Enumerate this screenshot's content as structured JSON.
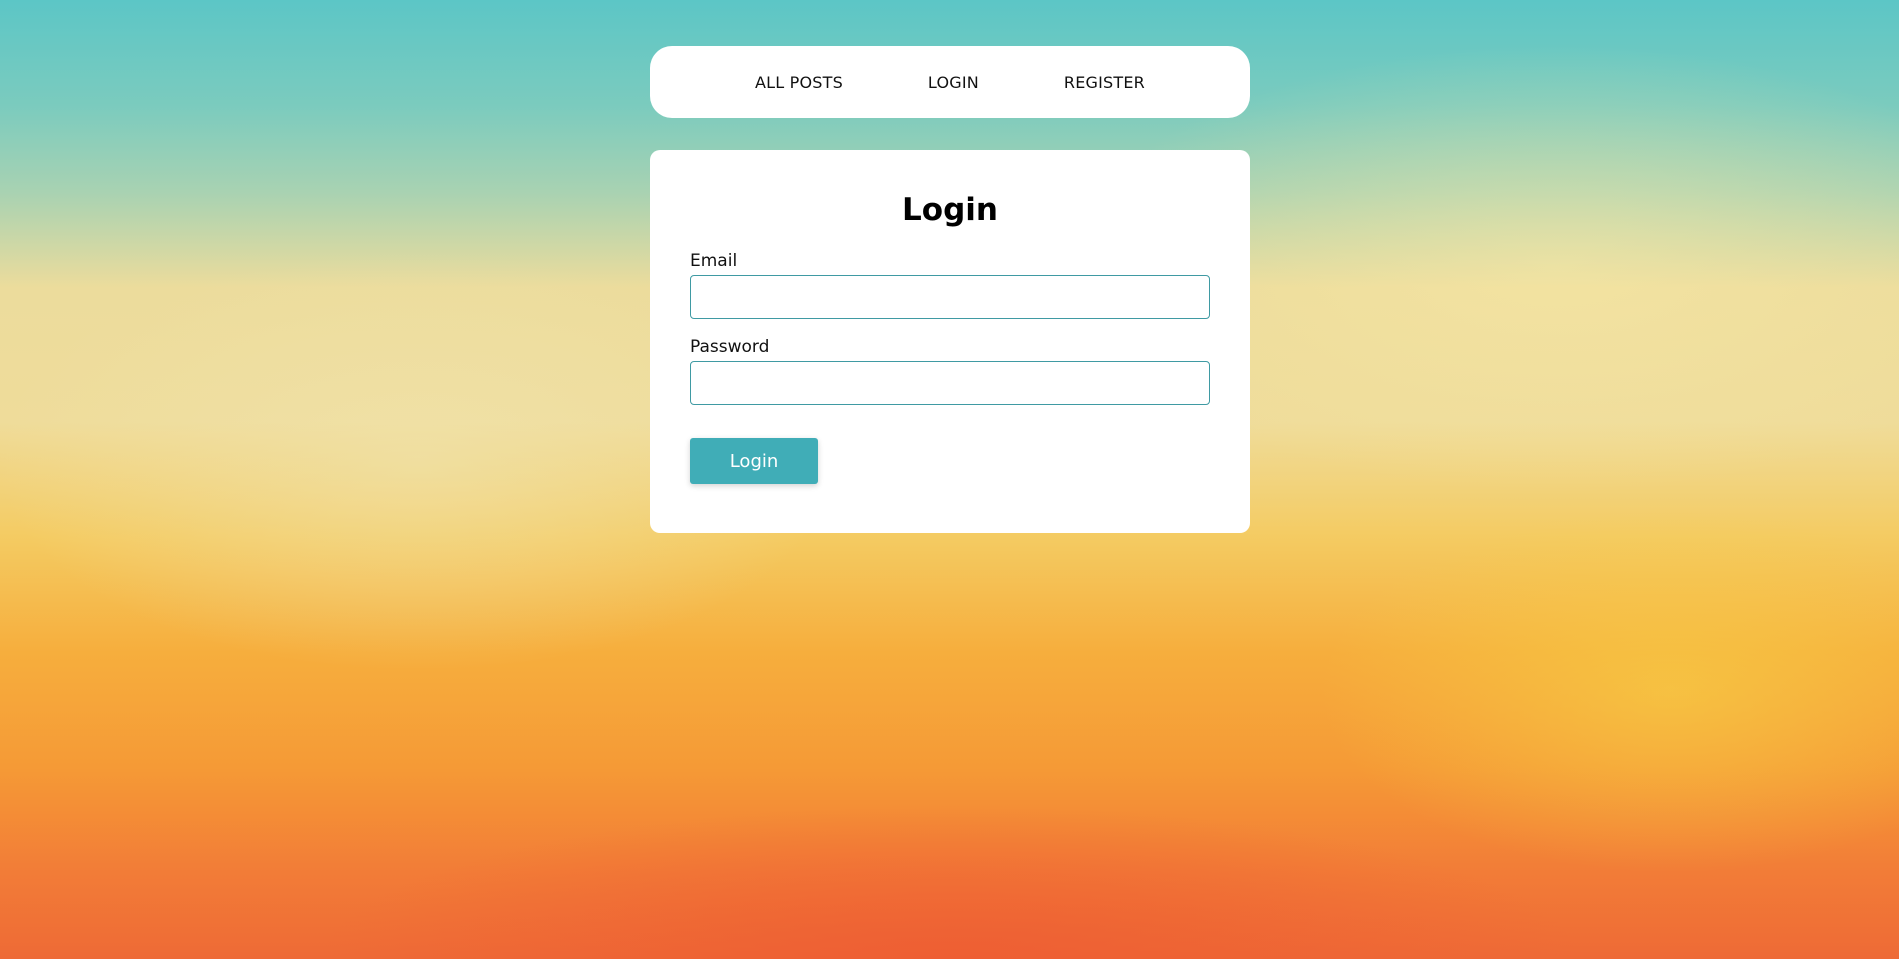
{
  "nav": {
    "items": [
      {
        "label": "ALL POSTS"
      },
      {
        "label": "LOGIN"
      },
      {
        "label": "REGISTER"
      }
    ]
  },
  "form": {
    "title": "Login",
    "email_label": "Email",
    "email_value": "",
    "password_label": "Password",
    "password_value": "",
    "submit_label": "Login"
  },
  "colors": {
    "accent": "#40adb7",
    "input_border": "#3f9aa3",
    "card_background": "#ffffff"
  }
}
